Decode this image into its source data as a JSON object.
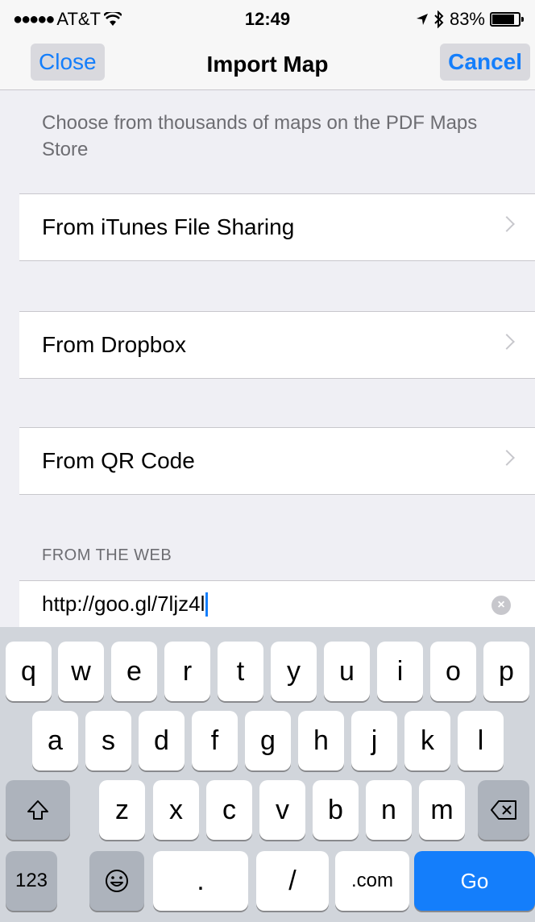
{
  "status_bar": {
    "signal": "●●●●●",
    "carrier": "AT&T",
    "wifi_icon": "wifi-icon",
    "time": "12:49",
    "location_icon": "location-arrow-icon",
    "bluetooth_icon": "bluetooth-icon",
    "battery_percent": "83%",
    "battery_level": 0.83
  },
  "nav": {
    "close_label": "Close",
    "title": "Import Map",
    "cancel_label": "Cancel"
  },
  "store_note": "Choose from thousands of maps on the PDF Maps Store",
  "sources": [
    {
      "label": "From iTunes File Sharing"
    },
    {
      "label": "From Dropbox"
    },
    {
      "label": "From QR Code"
    }
  ],
  "web": {
    "header": "FROM THE WEB",
    "url_value": "http://goo.gl/7ljz4l",
    "clear_icon": "clear-circle-icon"
  },
  "keyboard": {
    "row1": [
      "q",
      "w",
      "e",
      "r",
      "t",
      "y",
      "u",
      "i",
      "o",
      "p"
    ],
    "row2": [
      "a",
      "s",
      "d",
      "f",
      "g",
      "h",
      "j",
      "k",
      "l"
    ],
    "row3": [
      "z",
      "x",
      "c",
      "v",
      "b",
      "n",
      "m"
    ],
    "shift_icon": "shift-icon",
    "delete_icon": "delete-icon",
    "numbers_label": "123",
    "emoji_icon": "emoji-icon",
    "period": ".",
    "slash": "/",
    "dotcom": ".com",
    "go_label": "Go"
  },
  "colors": {
    "accent": "#147efb",
    "background": "#efeff4",
    "keyboard": "#d1d5db"
  }
}
